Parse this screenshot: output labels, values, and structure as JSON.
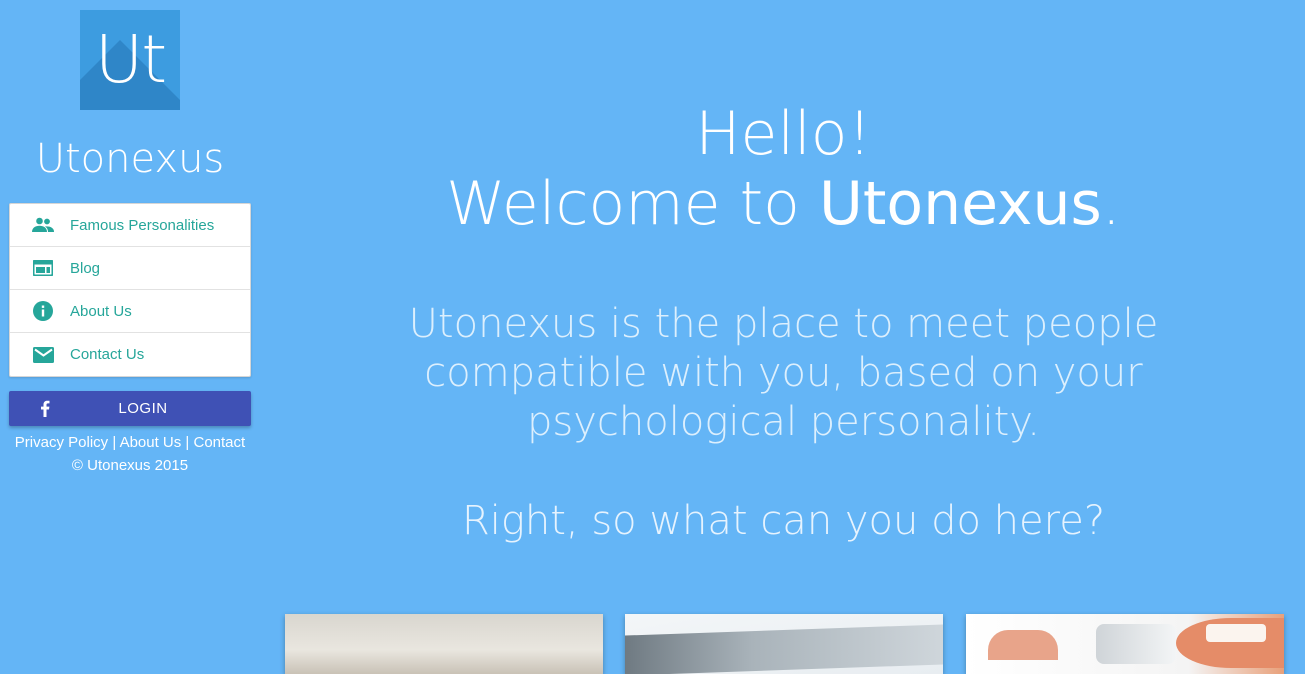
{
  "sidebar": {
    "logo_text": "Ut",
    "brand": "Utonexus",
    "nav": [
      {
        "label": "Famous Personalities",
        "icon": "people-icon"
      },
      {
        "label": "Blog",
        "icon": "web-icon"
      },
      {
        "label": "About Us",
        "icon": "info-icon"
      },
      {
        "label": "Contact Us",
        "icon": "mail-icon"
      }
    ],
    "login": {
      "label": "LOGIN",
      "icon": "facebook-icon"
    },
    "footer_links": {
      "privacy": "Privacy Policy",
      "about": "About Us",
      "contact": "Contact",
      "separator": " | "
    },
    "copyright": "© Utonexus 2015"
  },
  "main": {
    "hello": "Hello!",
    "welcome_prefix": "Welcome to ",
    "welcome_brand": "Utonexus",
    "welcome_suffix": ".",
    "tagline": "Utonexus is the place to meet people compatible with you, based on your psychological personality.",
    "question": "Right, so what can you do here?"
  },
  "colors": {
    "background": "#64b5f6",
    "logo_bg": "#3d9ce0",
    "nav_text": "#26a69a",
    "login_bg": "#3f51b5"
  }
}
